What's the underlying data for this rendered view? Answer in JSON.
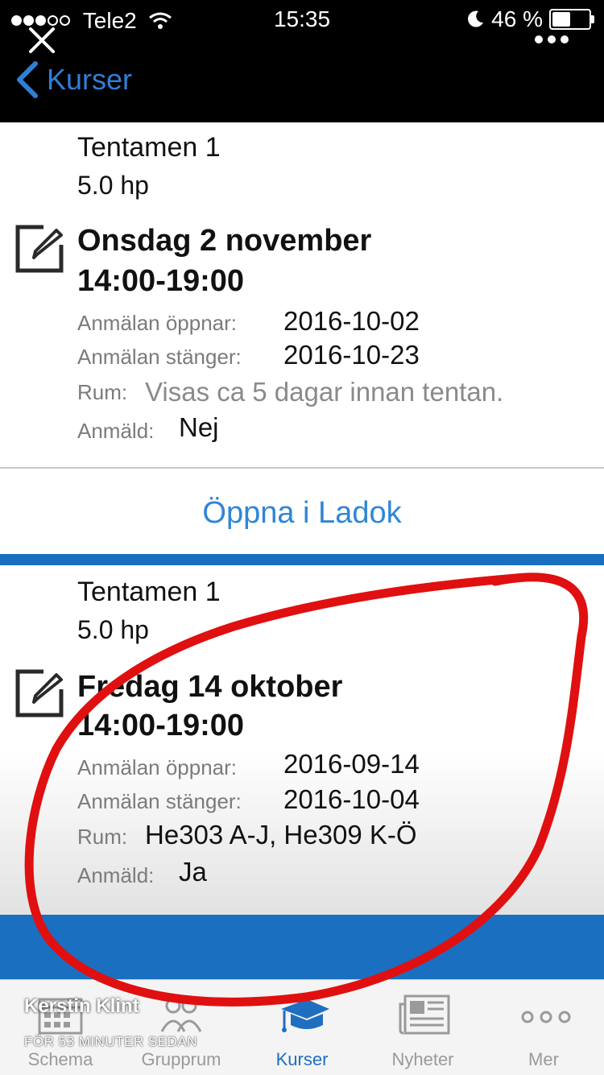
{
  "status_bar": {
    "carrier": "Tele2",
    "time": "15:35",
    "battery": "46 %"
  },
  "nav": {
    "back_label": "Kurser"
  },
  "exams": [
    {
      "title": "Tentamen 1",
      "credits": "5.0 hp",
      "date": "Onsdag 2 november",
      "time": "14:00-19:00",
      "opens_label": "Anmälan öppnar:",
      "opens_value": "2016-10-02",
      "closes_label": "Anmälan stänger:",
      "closes_value": "2016-10-23",
      "room_label": "Rum:",
      "room_value": "Visas ca 5 dagar innan tentan.",
      "registered_label": "Anmäld:",
      "registered_value": "Nej"
    },
    {
      "title": "Tentamen 1",
      "credits": "5.0 hp",
      "date": "Fredag 14 oktober",
      "time": "14:00-19:00",
      "opens_label": "Anmälan öppnar:",
      "opens_value": "2016-09-14",
      "closes_label": "Anmälan stänger:",
      "closes_value": "2016-10-04",
      "room_label": "Rum:",
      "room_value": "He303 A-J, He309 K-Ö",
      "registered_label": "Anmäld:",
      "registered_value": "Ja"
    }
  ],
  "ladok_link": "Öppna i Ladok",
  "tabs": [
    {
      "label": "Schema",
      "icon": "calendar-icon"
    },
    {
      "label": "Grupprum",
      "icon": "group-icon"
    },
    {
      "label": "Kurser",
      "icon": "graduation-cap-icon"
    },
    {
      "label": "Nyheter",
      "icon": "newspaper-icon"
    },
    {
      "label": "Mer",
      "icon": "more-icon"
    }
  ],
  "story_overlay": {
    "name": "Kerstin Klint",
    "posted": "FÖR 53 MINUTER SEDAN"
  },
  "colors": {
    "accent": "#1a6fc0",
    "link": "#2f86d6",
    "annotation": "#e01010"
  }
}
